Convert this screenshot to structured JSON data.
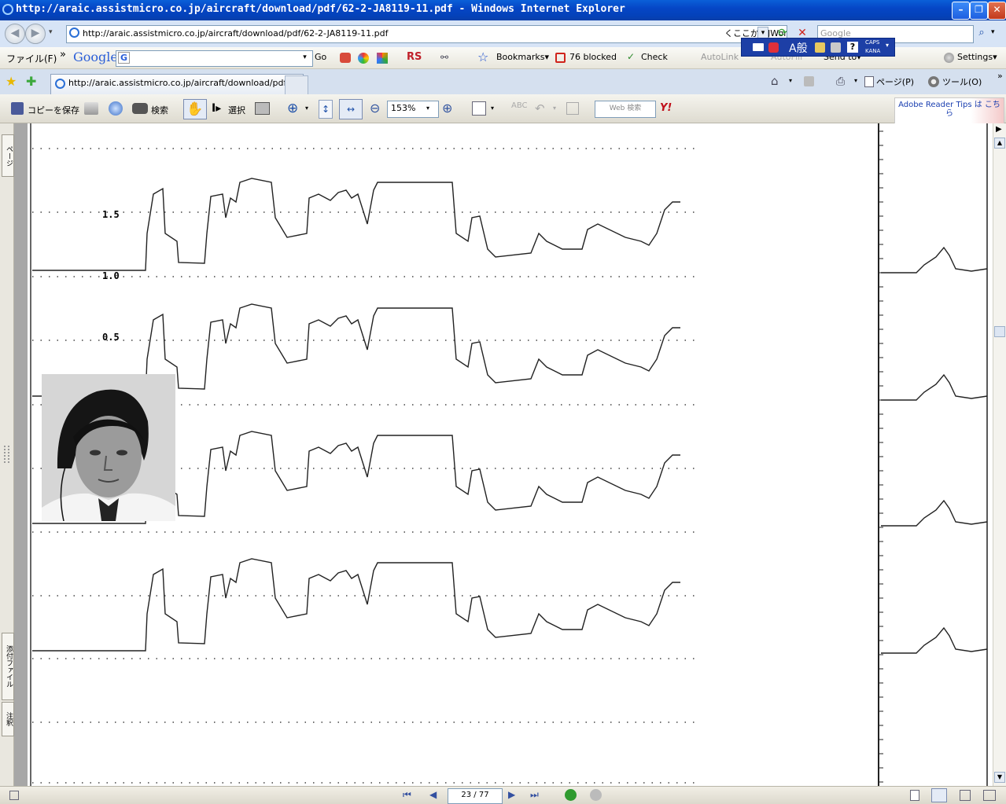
{
  "window": {
    "title": "http://araic.assistmicro.co.jp/aircraft/download/pdf/62-2-JA8119-11.pdf - Windows Internet Explorer",
    "min_label": "–",
    "max_label": "❐",
    "close_label": "✕"
  },
  "address": {
    "url": "http://araic.assistmicro.co.jp/aircraft/download/pdf/62-2-JA8119-11.pdf",
    "jword": "くここからJWord検索",
    "search_placeholder": "Google"
  },
  "menu": {
    "file": "ファイル(F)",
    "chevron": "»"
  },
  "google_toolbar": {
    "brand": "Google",
    "go": "Go",
    "rs": "RS",
    "bookmarks": "Bookmarks▾",
    "blocked": "76 blocked",
    "check": "Check",
    "autolink": "AutoLink",
    "autofill": "AutoFill",
    "sendto": "Send to▾",
    "settings": "Settings▾"
  },
  "ime": {
    "mode": "A般",
    "caps": "CAPS",
    "kana": "KANA"
  },
  "tabs": {
    "active": "http://araic.assistmicro.co.jp/aircraft/download/pdf...",
    "page_menu": "ページ(P)",
    "tools_menu": "ツール(O)"
  },
  "acrobat": {
    "save_copy": "コピーを保存",
    "search": "検索",
    "select": "選択",
    "zoom": "153%",
    "web_search": "Web 検索",
    "yahoo": "Y!",
    "tips": "Adobe Reader Tips は こちら"
  },
  "side_tabs": {
    "pages": "ページ",
    "attachments": "添付ファイル",
    "comments": "注釈"
  },
  "status": {
    "page": "23 / 77"
  },
  "chart_data": {
    "type": "line",
    "ytick_labels": [
      "1.5",
      "1.0",
      "0.5"
    ]
  }
}
